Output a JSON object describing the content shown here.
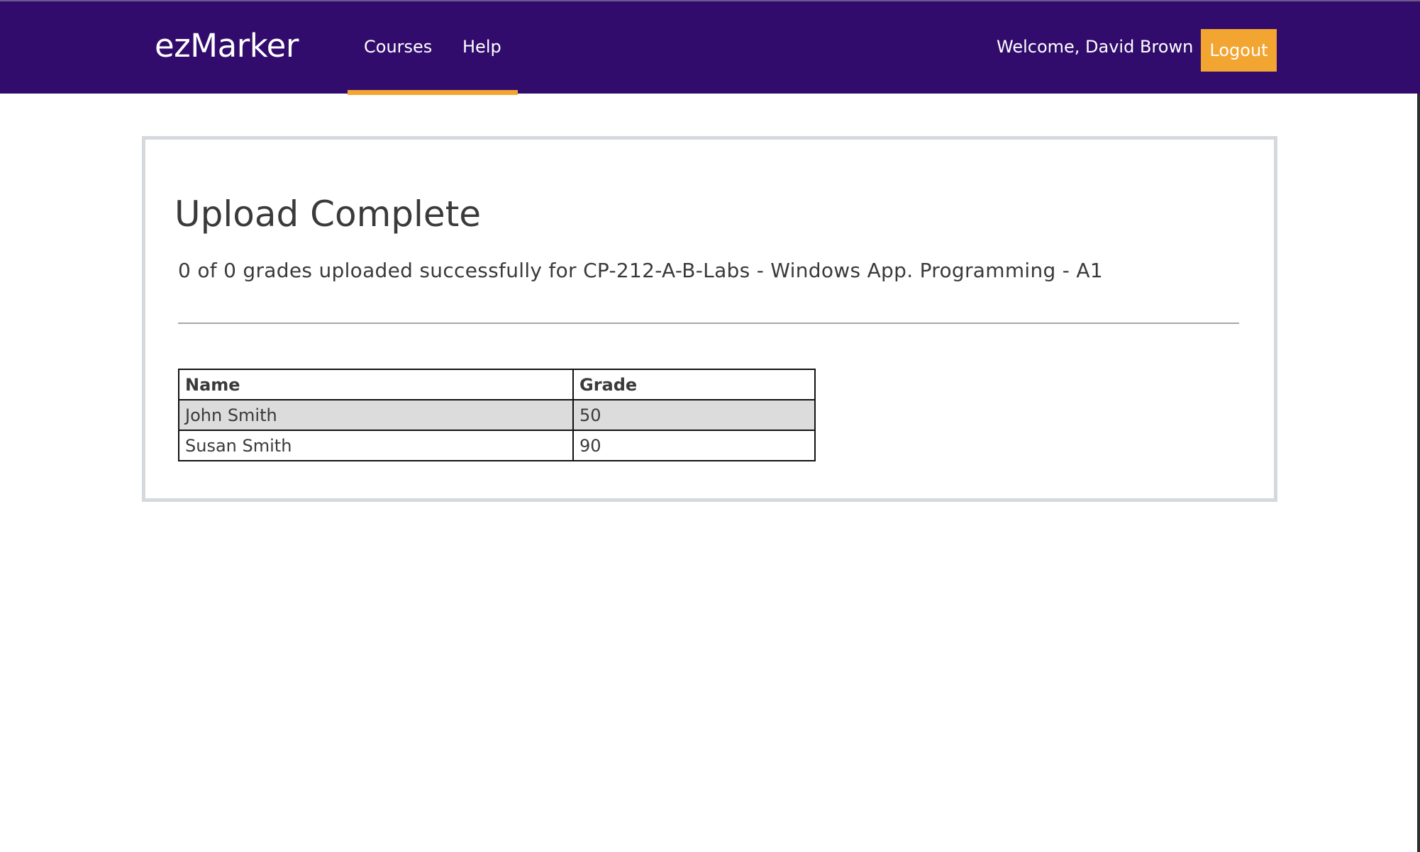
{
  "navbar": {
    "brand": "ezMarker",
    "links": [
      {
        "label": "Courses",
        "active": true
      },
      {
        "label": "Help",
        "active": false
      }
    ],
    "welcome": "Welcome, David Brown",
    "logout_label": "Logout"
  },
  "main": {
    "title": "Upload Complete",
    "subtitle": "0 of 0 grades uploaded successfully for CP-212-A-B-Labs - Windows App. Programming - A1",
    "table": {
      "headers": [
        "Name",
        "Grade"
      ],
      "rows": [
        {
          "name": "John Smith",
          "grade": "50"
        },
        {
          "name": "Susan Smith",
          "grade": "90"
        }
      ]
    }
  },
  "colors": {
    "navbar": "#320c6d",
    "accent": "#f2a531",
    "panel_border": "#d5d8de",
    "shaded_row": "#dcdcdc"
  }
}
